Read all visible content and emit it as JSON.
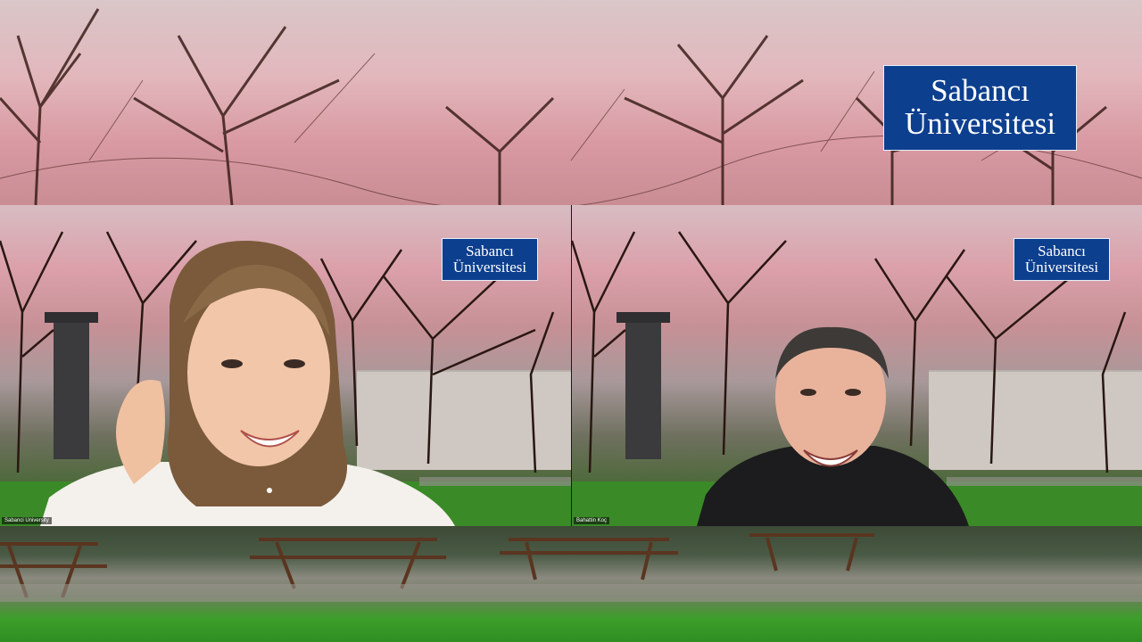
{
  "background": {
    "logo": {
      "line1": "Sabancı",
      "line2": "Üniversitesi",
      "color": "#0d3f8f"
    }
  },
  "participants": [
    {
      "tile": "left",
      "name": "Sabanci University",
      "logo": {
        "line1": "Sabancı",
        "line2": "Üniversitesi"
      }
    },
    {
      "tile": "right",
      "name": "Bahattin Koç",
      "logo": {
        "line1": "Sabancı",
        "line2": "Üniversitesi"
      }
    }
  ]
}
